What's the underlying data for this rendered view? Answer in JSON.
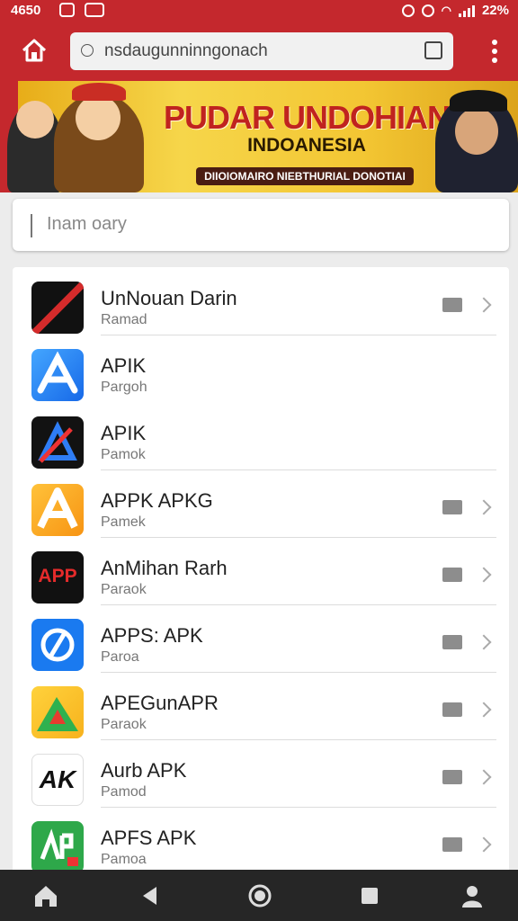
{
  "status_bar": {
    "time": "4650",
    "battery": "22%"
  },
  "browser": {
    "url": "nsdaugunninngonach"
  },
  "banner": {
    "title": "PUDAR UNDOHIAN",
    "subtitle": "INDOANESIA",
    "ribbon": "DIIOIOMAIRO NIEBTHURIAL DONOTIAI"
  },
  "search": {
    "text": "Inam oary"
  },
  "apps": [
    {
      "name": "UnNouan Darin",
      "sub": "Ramad",
      "icon": "black-red-stripe-icon",
      "download": true
    },
    {
      "name": "APIK",
      "sub": "Pargoh",
      "icon": "blue-a-icon",
      "download": false
    },
    {
      "name": "APIK",
      "sub": "Pamok",
      "icon": "dark-a-icon",
      "download": false
    },
    {
      "name": "APPK APKG",
      "sub": "Pamek",
      "icon": "orange-a-icon",
      "download": true
    },
    {
      "name": "AnMihan Rarh",
      "sub": "Paraok",
      "icon": "app-red-text-icon",
      "icon_text": "APP",
      "download": true
    },
    {
      "name": "APPS: APK",
      "sub": "Paroa",
      "icon": "blue-slash-circle-icon",
      "download": true
    },
    {
      "name": "APEGunAPR",
      "sub": "Paraok",
      "icon": "green-triangle-icon",
      "download": true
    },
    {
      "name": "Aurb  APK",
      "sub": "Pamod",
      "icon": "black-ak-logo-icon",
      "icon_text": "AK",
      "download": true
    },
    {
      "name": "APFS APK",
      "sub": "Pamoa",
      "icon": "green-ap-icon",
      "download": true
    }
  ],
  "colors": {
    "brand": "#c4282d",
    "banner": "#f3c633"
  }
}
